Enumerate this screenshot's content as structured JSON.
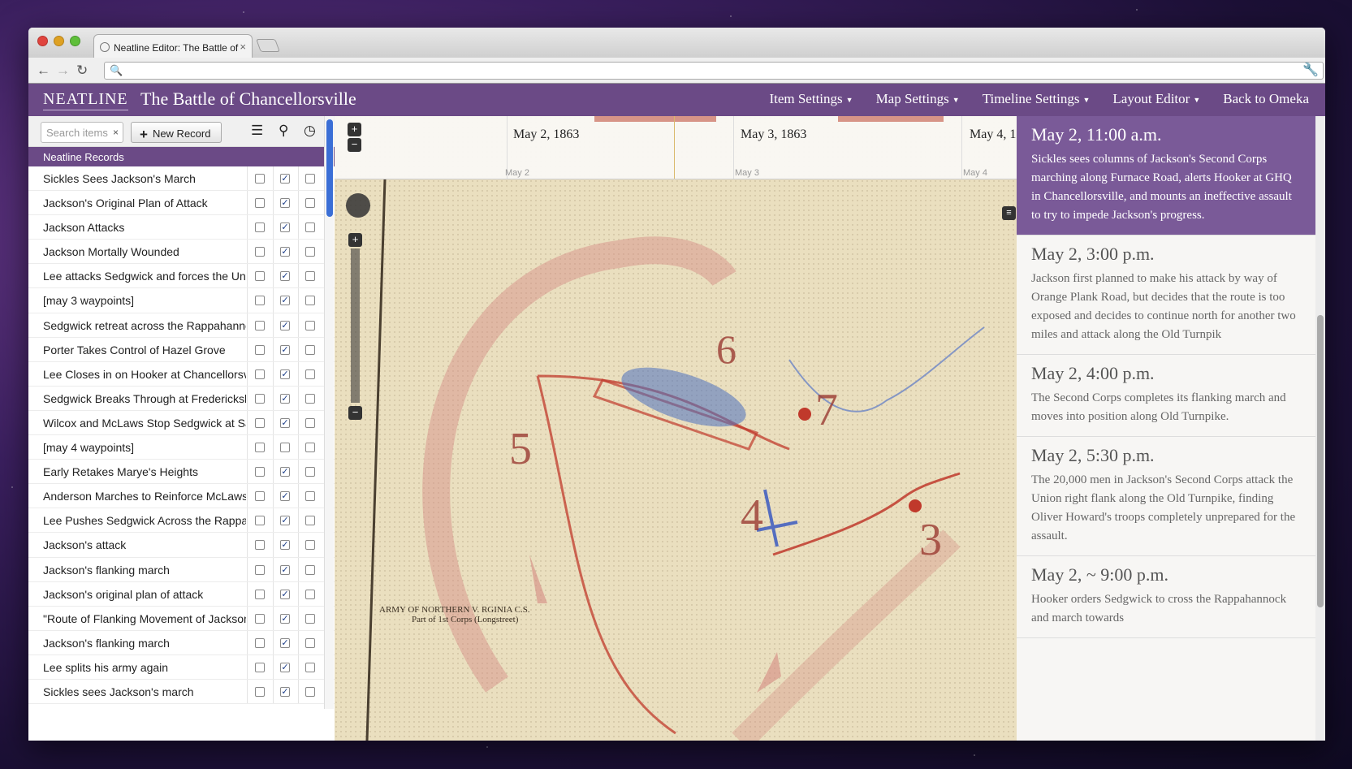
{
  "browser": {
    "tab_title": "Neatline Editor: The Battle of",
    "tab_close": "×",
    "back": "←",
    "forward": "→",
    "reload": "↻",
    "search_glyph": "🔍",
    "wrench_glyph": "🔧"
  },
  "app": {
    "logo": "NEATLINE",
    "title": "The Battle of Chancellorsville",
    "menu": [
      {
        "label": "Item Settings"
      },
      {
        "label": "Map Settings"
      },
      {
        "label": "Timeline Settings"
      },
      {
        "label": "Layout Editor"
      }
    ],
    "back_link": "Back to Omeka",
    "accent": "#6b4a86"
  },
  "sidebar": {
    "search_placeholder": "Search items",
    "search_clear": "×",
    "new_record": "New Record",
    "new_record_glyph": "+",
    "icons": {
      "list": "☰",
      "map": "⚲",
      "time": "◷"
    },
    "header": "Neatline Records",
    "check": "✓",
    "records": [
      {
        "name": "Sickles Sees Jackson's March",
        "map": true
      },
      {
        "name": "Jackson's Original Plan of Attack",
        "map": true
      },
      {
        "name": "Jackson Attacks",
        "map": true
      },
      {
        "name": "Jackson Mortally Wounded",
        "map": true
      },
      {
        "name": "Lee attacks Sedgwick and forces the Unio",
        "map": true
      },
      {
        "name": "[may 3 waypoints]",
        "map": true
      },
      {
        "name": "Sedgwick retreat across the Rappahanno",
        "map": true
      },
      {
        "name": "Porter Takes Control of Hazel Grove",
        "map": true
      },
      {
        "name": "Lee Closes in on Hooker at Chancellorsvi",
        "map": true
      },
      {
        "name": "Sedgwick Breaks Through at Fredericksb",
        "map": true
      },
      {
        "name": "Wilcox and McLaws Stop Sedgwick at Sa",
        "map": true
      },
      {
        "name": "[may 4 waypoints]",
        "map": false
      },
      {
        "name": "Early Retakes Marye's Heights",
        "map": true
      },
      {
        "name": "Anderson Marches to Reinforce McLaws",
        "map": true
      },
      {
        "name": "Lee Pushes Sedgwick Across the Rappah",
        "map": true
      },
      {
        "name": "Jackson's attack",
        "map": true
      },
      {
        "name": "Jackson's flanking march",
        "map": true
      },
      {
        "name": "Jackson's original plan of attack",
        "map": true
      },
      {
        "name": "\"Route of Flanking Movement of Jackson'",
        "map": true
      },
      {
        "name": "Jackson's flanking march",
        "map": true
      },
      {
        "name": "Lee splits his army again",
        "map": true
      },
      {
        "name": "Sickles sees Jackson's march",
        "map": true
      }
    ]
  },
  "timeline": {
    "dates": [
      "May 2, 1863",
      "May 3, 1863",
      "May 4, 1"
    ],
    "subs": [
      "May 2",
      "May 3",
      "May 4"
    ]
  },
  "map": {
    "labels": [
      "6",
      "7",
      "5",
      "4",
      "3"
    ],
    "legend": [
      "ARMY OF NORTHERN V. RGINIA C.S.",
      "Part of 1st Corps (Longstreet)"
    ],
    "zoom_in": "+",
    "zoom_out": "−"
  },
  "narrative": [
    {
      "time": "May 2, 11:00 a.m.",
      "text": "Sickles sees columns of Jackson's Second Corps marching along Furnace Road, alerts Hooker at GHQ in Chancellorsville, and mounts an ineffective assault to try to impede Jackson's progress.",
      "active": true
    },
    {
      "time": "May 2, 3:00 p.m.",
      "text": "Jackson first planned to make his attack by way of Orange Plank Road, but decides that the route is too exposed and decides to continue north for another two miles and attack along the Old Turnpik"
    },
    {
      "time": "May 2, 4:00 p.m.",
      "text": "The Second Corps completes its flanking march and moves into position along Old Turnpike."
    },
    {
      "time": "May 2, 5:30 p.m.",
      "text": "The 20,000 men in Jackson's Second Corps attack the Union right flank along the Old Turnpike, finding Oliver Howard's troops completely unprepared for the assault."
    },
    {
      "time": "May 2, ~ 9:00 p.m.",
      "text": "Hooker orders Sedgwick to cross the Rappahannock and march towards"
    }
  ]
}
